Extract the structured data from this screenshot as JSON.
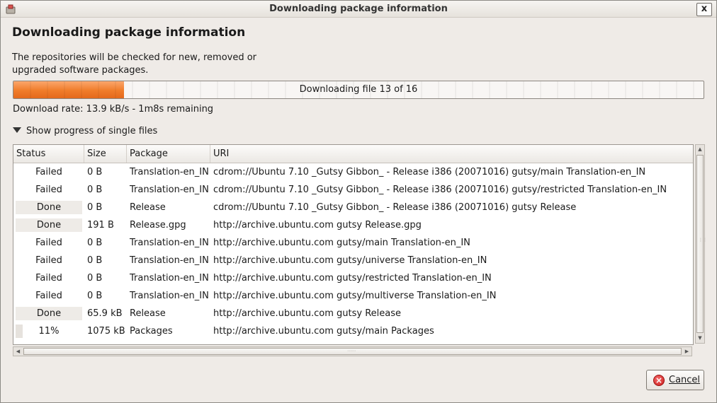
{
  "window": {
    "title": "Downloading package information",
    "close_glyph": "x",
    "app_icon": "package-manager-icon"
  },
  "dialog": {
    "heading": "Downloading package information",
    "description": "The repositories will be checked for new, removed or\nupgraded software packages.",
    "progress": {
      "text": "Downloading file 13 of 16",
      "fraction": 0.16
    },
    "rate": "Download rate: 13.9 kB/s - 1m8s remaining",
    "expander_label": "Show progress of single files",
    "cancel_label": "Cancel",
    "cancel_icon": "cancel-icon"
  },
  "table": {
    "columns": [
      "Status",
      "Size",
      "Package",
      "URI"
    ],
    "rows": [
      {
        "status": "Failed",
        "progress": 0,
        "size": "0  B",
        "package": "Translation-en_IN",
        "uri": "cdrom://Ubuntu 7.10 _Gutsy Gibbon_ - Release i386 (20071016) gutsy/main Translation-en_IN"
      },
      {
        "status": "Failed",
        "progress": 0,
        "size": "0  B",
        "package": "Translation-en_IN",
        "uri": "cdrom://Ubuntu 7.10 _Gutsy Gibbon_ - Release i386 (20071016) gutsy/restricted Translation-en_IN"
      },
      {
        "status": "Done",
        "progress": 1,
        "size": "0  B",
        "package": "Release",
        "uri": "cdrom://Ubuntu 7.10 _Gutsy Gibbon_ - Release i386 (20071016) gutsy Release"
      },
      {
        "status": "Done",
        "progress": 1,
        "size": "191  B",
        "package": "Release.gpg",
        "uri": "http://archive.ubuntu.com gutsy Release.gpg"
      },
      {
        "status": "Failed",
        "progress": 0,
        "size": "0  B",
        "package": "Translation-en_IN",
        "uri": "http://archive.ubuntu.com gutsy/main Translation-en_IN"
      },
      {
        "status": "Failed",
        "progress": 0,
        "size": "0  B",
        "package": "Translation-en_IN",
        "uri": "http://archive.ubuntu.com gutsy/universe Translation-en_IN"
      },
      {
        "status": "Failed",
        "progress": 0,
        "size": "0  B",
        "package": "Translation-en_IN",
        "uri": "http://archive.ubuntu.com gutsy/restricted Translation-en_IN"
      },
      {
        "status": "Failed",
        "progress": 0,
        "size": "0  B",
        "package": "Translation-en_IN",
        "uri": "http://archive.ubuntu.com gutsy/multiverse Translation-en_IN"
      },
      {
        "status": "Done",
        "progress": 1,
        "size": "65.9 kB",
        "package": "Release",
        "uri": "http://archive.ubuntu.com gutsy Release"
      },
      {
        "status": "11%",
        "progress": 0.11,
        "size": "1075 kB",
        "package": "Packages",
        "uri": "http://archive.ubuntu.com gutsy/main Packages"
      }
    ]
  },
  "colors": {
    "progress_accent": "#f07c2a",
    "cancel_icon": "#cc1b1b"
  }
}
